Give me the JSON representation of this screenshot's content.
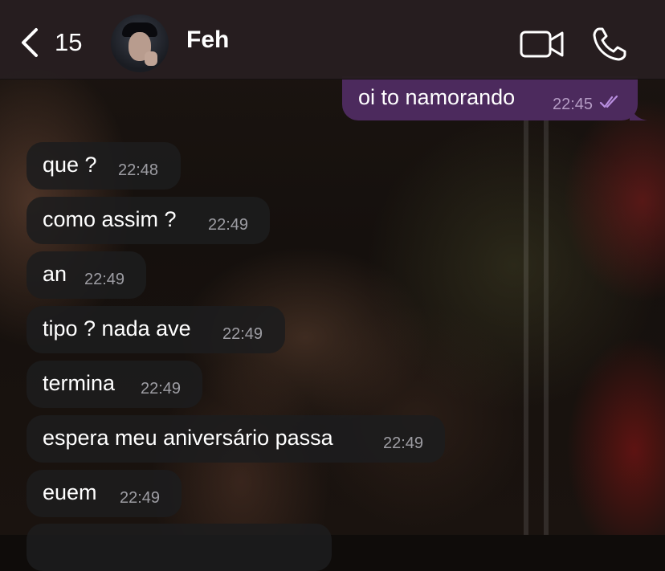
{
  "header": {
    "back_count": "15",
    "contact_name": "Feh",
    "icons": {
      "back": "chevron-left-icon",
      "avatar": "contact-avatar",
      "video": "video-camera-icon",
      "call": "phone-icon"
    }
  },
  "colors": {
    "header_bg": "#261e20",
    "incoming_bubble": "#1c1c1e",
    "outgoing_bubble": "#4c2a5d",
    "read_ticks": "#b98fe0"
  },
  "messages": [
    {
      "direction": "out",
      "text": "oi to namorando",
      "time": "22:45",
      "status": "read"
    },
    {
      "direction": "in",
      "text": "que ?",
      "time": "22:48"
    },
    {
      "direction": "in",
      "text": "como assim ?",
      "time": "22:49"
    },
    {
      "direction": "in",
      "text": "an",
      "time": "22:49"
    },
    {
      "direction": "in",
      "text": "tipo ? nada ave",
      "time": "22:49"
    },
    {
      "direction": "in",
      "text": "termina",
      "time": "22:49"
    },
    {
      "direction": "in",
      "text": "espera meu aniversário passa",
      "time": "22:49"
    },
    {
      "direction": "in",
      "text": "euem",
      "time": "22:49"
    }
  ]
}
